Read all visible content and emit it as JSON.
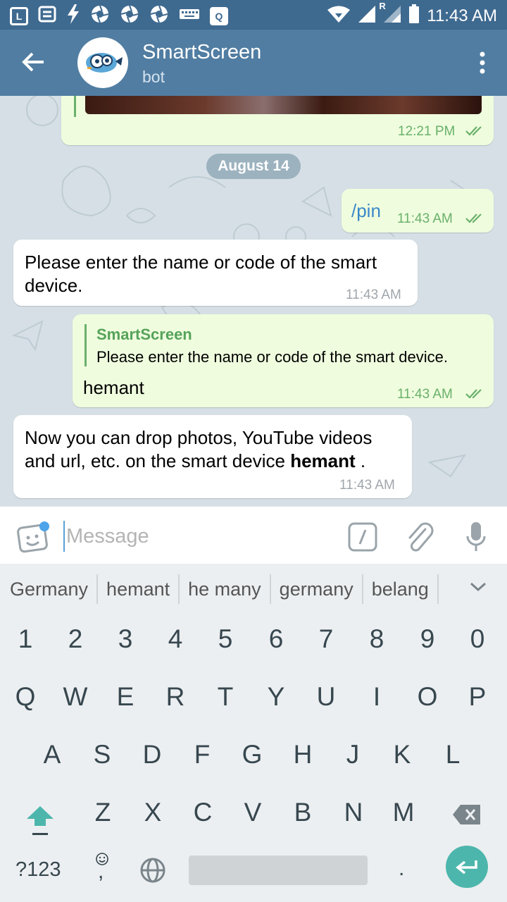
{
  "status_bar": {
    "time": "11:43 AM",
    "left_icons": [
      "app-l-icon",
      "message-icon",
      "flash-icon",
      "aperture-icon",
      "aperture-icon",
      "aperture-icon",
      "keyboard-icon",
      "q-app-icon"
    ],
    "right_icons": [
      "wifi-icon",
      "signal-icon",
      "roaming-signal-icon",
      "battery-icon"
    ],
    "roaming_label": "R"
  },
  "header": {
    "title": "SmartScreen",
    "subtitle": "bot"
  },
  "chat": {
    "date_separator": "August 14",
    "messages": [
      {
        "direction": "out",
        "time": "12:21 PM",
        "ticks": "double",
        "type": "image"
      },
      {
        "direction": "out",
        "text": "/pin",
        "time": "11:43 AM",
        "ticks": "double"
      },
      {
        "direction": "in",
        "text_line1": "Please enter the name or code of the smart",
        "text_line2": "device.",
        "time": "11:43 AM"
      },
      {
        "direction": "out",
        "reply_to_name": "SmartScreen",
        "reply_to_text": "Please enter the name or code of the smart device.",
        "text": "hemant",
        "time": "11:43 AM",
        "ticks": "double"
      },
      {
        "direction": "in",
        "text_line1": "Now you can drop photos, YouTube videos",
        "text_line2_prefix": "and url, etc. on the smart device ",
        "text_line2_bold": "hemant",
        "text_line2_suffix": " .",
        "time": "11:43 AM"
      }
    ]
  },
  "composer": {
    "placeholder": "Message",
    "value": "",
    "icons": [
      "sticker-icon",
      "bot-command-icon",
      "attach-icon",
      "mic-icon"
    ]
  },
  "keyboard": {
    "suggestions": [
      "Germany",
      "hemant",
      "he many",
      "germany",
      "belang"
    ],
    "row_numbers": [
      "1",
      "2",
      "3",
      "4",
      "5",
      "6",
      "7",
      "8",
      "9",
      "0"
    ],
    "row1": [
      "Q",
      "W",
      "E",
      "R",
      "T",
      "Y",
      "U",
      "I",
      "O",
      "P"
    ],
    "row2": [
      "A",
      "S",
      "D",
      "F",
      "G",
      "H",
      "J",
      "K",
      "L"
    ],
    "row3": [
      "Z",
      "X",
      "C",
      "V",
      "B",
      "N",
      "M"
    ],
    "symbols_label": "?123",
    "comma": ",",
    "period": ".",
    "colors": {
      "accent": "#4db6ac",
      "header": "#517da2",
      "outgoing_bubble": "#effdde"
    }
  }
}
